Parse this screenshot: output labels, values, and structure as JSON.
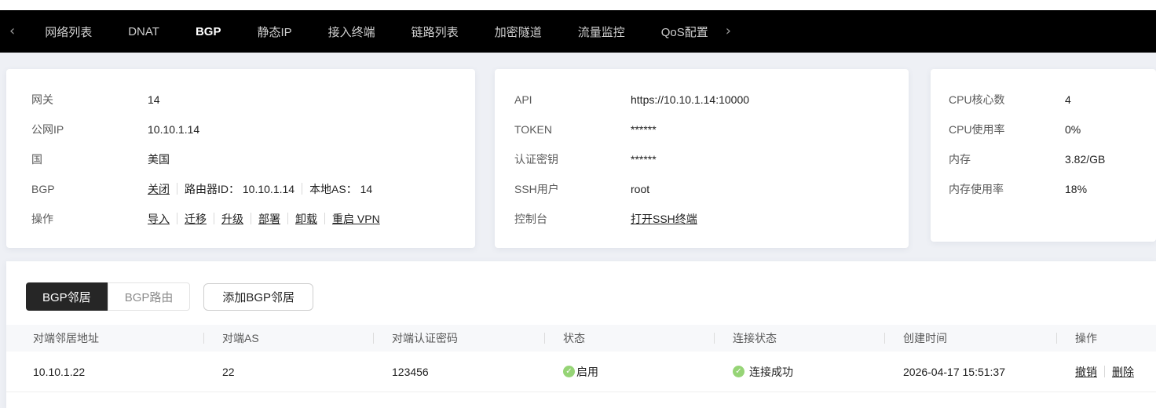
{
  "nav": {
    "items": [
      {
        "label": "网络列表",
        "active": false
      },
      {
        "label": "DNAT",
        "active": false
      },
      {
        "label": "BGP",
        "active": true
      },
      {
        "label": "静态IP",
        "active": false
      },
      {
        "label": "接入终端",
        "active": false
      },
      {
        "label": "链路列表",
        "active": false
      },
      {
        "label": "加密隧道",
        "active": false
      },
      {
        "label": "流量监控",
        "active": false
      },
      {
        "label": "QoS配置",
        "active": false
      }
    ],
    "back_chevron": "‹",
    "forward_chevron": "›"
  },
  "gateway_card": {
    "rows": [
      {
        "label": "网关",
        "value": "14"
      },
      {
        "label": "公网IP",
        "value": "10.10.1.14"
      },
      {
        "label": "国",
        "value": "美国"
      }
    ],
    "bgp": {
      "label": "BGP",
      "toggle_link": "关闭",
      "router_id": "路由器ID： 10.10.1.14",
      "local_as": "本地AS： 14"
    },
    "actions": {
      "label": "操作",
      "links": [
        "导入",
        "迁移",
        "升级",
        "部署",
        "卸载",
        "重启 VPN"
      ]
    }
  },
  "api_card": {
    "rows": [
      {
        "label": "API",
        "value": "https://10.10.1.14:10000"
      },
      {
        "label": "TOKEN",
        "value": "******"
      },
      {
        "label": "认证密钥",
        "value": "******"
      },
      {
        "label": "SSH用户",
        "value": "root"
      }
    ],
    "console": {
      "label": "控制台",
      "link": "打开SSH终端"
    }
  },
  "stats_card": {
    "rows": [
      {
        "label": "CPU核心数",
        "value": "4"
      },
      {
        "label": "CPU使用率",
        "value": "0%"
      },
      {
        "label": "内存",
        "value": "3.82/GB"
      },
      {
        "label": "内存使用率",
        "value": "18%"
      }
    ]
  },
  "bgp_section": {
    "tabs": [
      {
        "label": "BGP邻居",
        "active": true
      },
      {
        "label": "BGP路由",
        "active": false
      }
    ],
    "add_button": "添加BGP邻居",
    "table": {
      "columns": [
        "对端邻居地址",
        "对端AS",
        "对端认证密码",
        "状态",
        "连接状态",
        "创建时间",
        "操作"
      ],
      "rows": [
        {
          "neighbor_address": "10.10.1.22",
          "peer_as": "22",
          "auth_password": "123456",
          "status": "启用",
          "connection_status": "连接成功",
          "created_at": "2026-04-17 15:51:37",
          "action_revoke": "撤销",
          "action_delete": "删除"
        }
      ]
    }
  },
  "colors": {
    "nav_bg": "#000000",
    "page_bg": "#eef0f5",
    "active_tab_bg": "#262626",
    "success_green": "#96d476"
  }
}
